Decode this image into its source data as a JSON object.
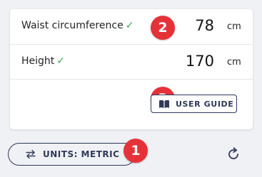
{
  "rows": [
    {
      "label": "Waist circumference",
      "check": "✓",
      "badge": "2",
      "value": "78",
      "unit": "cm"
    },
    {
      "label": "Height",
      "check": "✓",
      "badge": "3",
      "value": "170",
      "unit": "cm"
    }
  ],
  "user_guide": {
    "label": "USER GUIDE",
    "icon": "book-icon"
  },
  "units_button": {
    "label": "UNITS: METRIC",
    "badge": "1",
    "icon": "swap-arrows-icon"
  },
  "refresh": {
    "icon": "refresh-icon"
  },
  "colors": {
    "badge": "#e53238",
    "check": "#36a852",
    "button_outline": "#2e3a59",
    "background": "#f0f1f4",
    "card": "#ffffff"
  }
}
